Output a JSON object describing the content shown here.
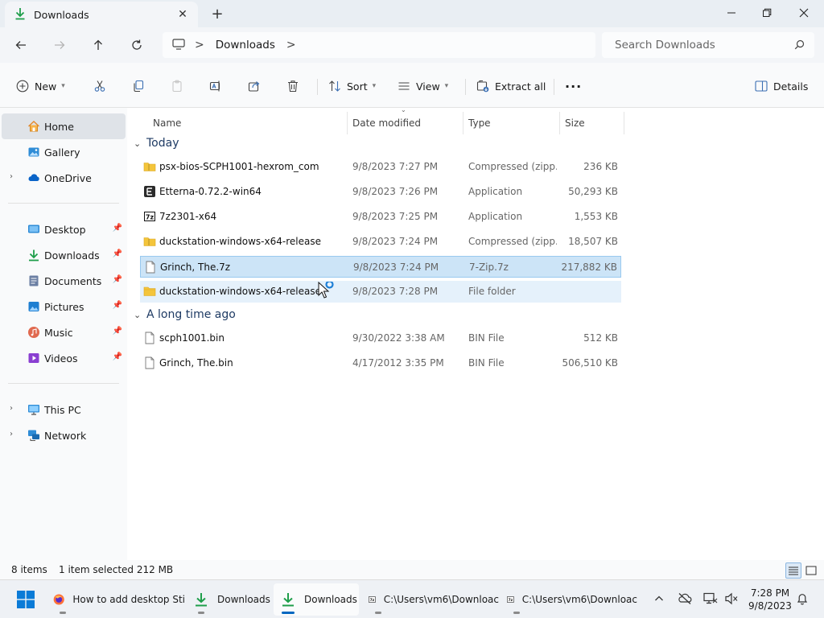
{
  "window": {
    "tab_title": "Downloads",
    "new_tab_label": "+",
    "minimize_label": "—",
    "maximize_label": "❐",
    "close_label": "✕"
  },
  "address": {
    "crumb": "Downloads",
    "separator": ">",
    "search_placeholder": "Search Downloads"
  },
  "toolbar": {
    "new_label": "New",
    "sort_label": "Sort",
    "view_label": "View",
    "extract_label": "Extract all",
    "more_label": "···",
    "details_label": "Details"
  },
  "sidebar": {
    "items": [
      {
        "label": "Home"
      },
      {
        "label": "Gallery"
      },
      {
        "label": "OneDrive"
      },
      {
        "label": "Desktop"
      },
      {
        "label": "Downloads"
      },
      {
        "label": "Documents"
      },
      {
        "label": "Pictures"
      },
      {
        "label": "Music"
      },
      {
        "label": "Videos"
      },
      {
        "label": "This PC"
      },
      {
        "label": "Network"
      }
    ]
  },
  "columns": {
    "name": "Name",
    "date": "Date modified",
    "type": "Type",
    "size": "Size"
  },
  "groups": {
    "today": "Today",
    "long_ago": "A long time ago"
  },
  "files": [
    {
      "name": "psx-bios-SCPH1001-hexrom_com",
      "date": "9/8/2023 7:27 PM",
      "type": "Compressed (zipp...",
      "size": "236 KB"
    },
    {
      "name": "Etterna-0.72.2-win64",
      "date": "9/8/2023 7:26 PM",
      "type": "Application",
      "size": "50,293 KB"
    },
    {
      "name": "7z2301-x64",
      "date": "9/8/2023 7:25 PM",
      "type": "Application",
      "size": "1,553 KB"
    },
    {
      "name": "duckstation-windows-x64-release",
      "date": "9/8/2023 7:24 PM",
      "type": "Compressed (zipp...",
      "size": "18,507 KB"
    },
    {
      "name": "Grinch, The.7z",
      "date": "9/8/2023 7:24 PM",
      "type": "7-Zip.7z",
      "size": "217,882 KB"
    },
    {
      "name": "duckstation-windows-x64-release",
      "date": "9/8/2023 7:28 PM",
      "type": "File folder",
      "size": ""
    },
    {
      "name": "scph1001.bin",
      "date": "9/30/2022 3:38 AM",
      "type": "BIN File",
      "size": "512 KB"
    },
    {
      "name": "Grinch, The.bin",
      "date": "4/17/2012 3:35 PM",
      "type": "BIN File",
      "size": "506,510 KB"
    }
  ],
  "status": {
    "count": "8 items",
    "selection": "1 item selected  212 MB"
  },
  "taskbar": {
    "firefox_label": "How to add desktop Sti",
    "explorer1_label": "Downloads",
    "explorer2_label": "Downloads",
    "zip1_label": "C:\\Users\\vm6\\Downloac",
    "zip2_label": "C:\\Users\\vm6\\Downloac",
    "time": "7:28 PM",
    "date": "9/8/2023"
  },
  "colors": {
    "accent": "#0067c0",
    "selection": "#cce4f7",
    "hover": "#e5f1fb",
    "download_green": "#1e9e4a",
    "folder_yellow": "#f4c53b"
  }
}
